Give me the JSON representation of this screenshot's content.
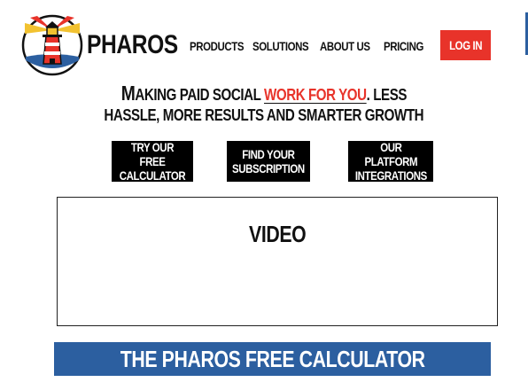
{
  "brand": {
    "name": "PHAROS"
  },
  "nav": {
    "items": [
      "PRODUCTS",
      "SOLUTIONS",
      "ABOUT US",
      "PRICING"
    ],
    "login_label": "LOG IN"
  },
  "tagline": {
    "first_cap": "M",
    "part1": "AKING PAID SOCIAL ",
    "highlight": "WORK FOR YOU",
    "part2": ". LESS",
    "line2": "HASSLE, MORE RESULTS AND SMARTER GROWTH"
  },
  "cta": [
    {
      "label": "TRY OUR FREE\nCALCULATOR"
    },
    {
      "label": "FIND YOUR\nSUBSCRIPTION"
    },
    {
      "label": "OUR PLATFORM\nINTEGRATIONS"
    }
  ],
  "video": {
    "label": "VIDEO"
  },
  "section": {
    "title": "THE PHAROS FREE CALCULATOR"
  },
  "colors": {
    "accent": "#e8332a",
    "brand_blue": "#2c5fa0",
    "black": "#000000"
  },
  "icons": {
    "logo": "lighthouse-logo-icon"
  }
}
